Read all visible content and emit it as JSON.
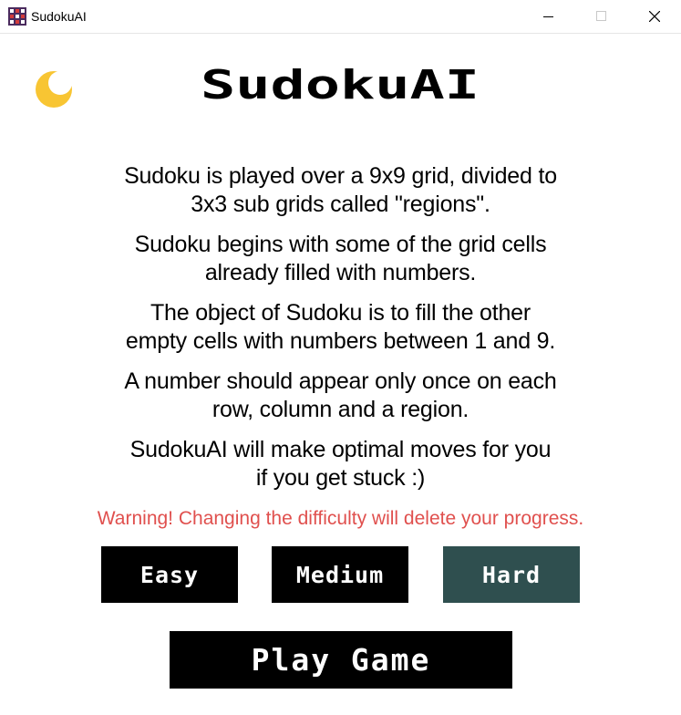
{
  "window": {
    "title": "SudokuAI",
    "app_icon": "sudoku-grid-icon",
    "controls": [
      "minimize-icon",
      "maximize-icon",
      "close-icon"
    ]
  },
  "theme_toggle": {
    "icon": "moon-icon",
    "color": "#f8c533"
  },
  "logo": {
    "text": "SudokuAI"
  },
  "rules": [
    "Sudoku is played over a 9x9 grid, divided to\n3x3 sub grids called \"regions\".",
    "Sudoku begins with some of the grid cells\nalready filled with numbers.",
    "The object of Sudoku is to fill the other\nempty cells with numbers between 1 and 9.",
    "A number should appear only once on each\nrow, column and a region.",
    "SudokuAI will make optimal moves for you\nif you get stuck :)"
  ],
  "warning": {
    "text": "Warning! Changing the difficulty will delete your progress.",
    "color": "#e0504e"
  },
  "difficulty": {
    "options": [
      "Easy",
      "Medium",
      "Hard"
    ],
    "selected": "Hard",
    "colors": {
      "default": "#000000",
      "selected": "#2f4f4f"
    }
  },
  "play_button": {
    "label": "Play Game"
  }
}
